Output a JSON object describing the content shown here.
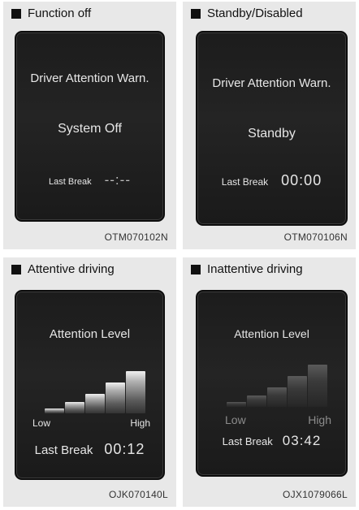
{
  "panels": [
    {
      "title": "Function off",
      "heading": "Driver Attention Warn.",
      "status": "System Off",
      "last_break_label": "Last Break",
      "last_break_value": "--:--",
      "code": "OTM070102N"
    },
    {
      "title": "Standby/Disabled",
      "heading": "Driver Attention Warn.",
      "status": "Standby",
      "last_break_label": "Last Break",
      "last_break_value": "00:00",
      "code": "OTM070106N"
    },
    {
      "title": "Attentive driving",
      "heading": "Attention Level",
      "low_label": "Low",
      "high_label": "High",
      "attention_level_lit_bars": 5,
      "last_break_label": "Last Break",
      "last_break_value": "00:12",
      "code": "OJK070140L"
    },
    {
      "title": "Inattentive driving",
      "heading": "Attention Level",
      "low_label": "Low",
      "high_label": "High",
      "attention_level_lit_bars": 0,
      "last_break_label": "Last Break",
      "last_break_value": "03:42",
      "code": "OJX1079066L"
    }
  ],
  "colors": {
    "panel_background": "#e8e8e8",
    "screen_background": "#1f1f1f",
    "screen_text": "#e6e6e6",
    "dim_text": "#9a9a9a"
  }
}
